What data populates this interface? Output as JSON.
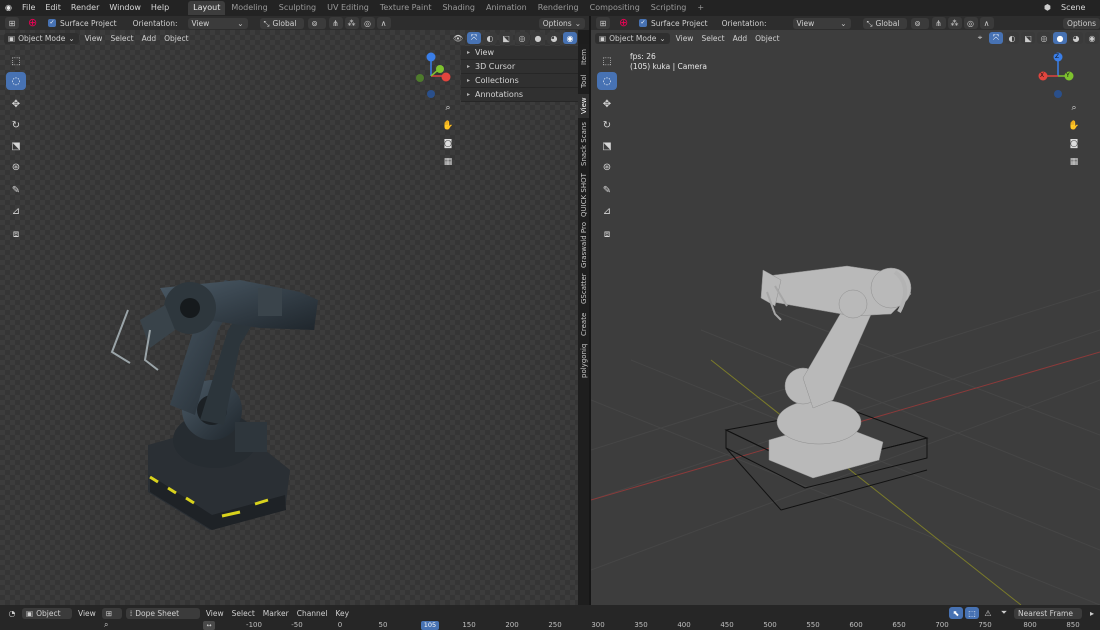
{
  "menu": [
    "File",
    "Edit",
    "Render",
    "Window",
    "Help"
  ],
  "workspaces": [
    {
      "label": "Layout",
      "active": true
    },
    {
      "label": "Modeling"
    },
    {
      "label": "Sculpting"
    },
    {
      "label": "UV Editing"
    },
    {
      "label": "Texture Paint"
    },
    {
      "label": "Shading"
    },
    {
      "label": "Animation"
    },
    {
      "label": "Rendering"
    },
    {
      "label": "Compositing"
    },
    {
      "label": "Scripting"
    }
  ],
  "add_workspace": "+",
  "scene_label": "Scene",
  "left": {
    "surface_project": "Surface Project",
    "orientation_label": "Orientation:",
    "orientation_value": "View",
    "transform": "Global",
    "options": "Options",
    "mode": "Object Mode",
    "menus": [
      "View",
      "Select",
      "Add",
      "Object"
    ],
    "npanel_rows": [
      "View",
      "3D Cursor",
      "Collections",
      "Annotations"
    ],
    "side_tabs": [
      "Item",
      "Tool",
      "View",
      "Snack Scans",
      "QUICK SHOT",
      "Graswald Pro",
      "GScatter",
      "Create",
      "polygoniq"
    ]
  },
  "right": {
    "surface_project": "Surface Project",
    "orientation_label": "Orientation:",
    "orientation_value": "View",
    "transform": "Global",
    "options": "Options",
    "mode": "Object Mode",
    "menus": [
      "View",
      "Select",
      "Add",
      "Object"
    ],
    "fps": "fps: 26",
    "camera": "(105) kuka | Camera"
  },
  "gizmo_axes": {
    "x": "X",
    "y": "Y",
    "z": "Z"
  },
  "timeline": {
    "object": "Object",
    "view": "View",
    "dope_sheet": "Dope Sheet",
    "menus": [
      "View",
      "Select",
      "Marker",
      "Channel",
      "Key"
    ],
    "interpolation": "Nearest Frame",
    "current_frame": "105",
    "ticks": [
      "-100",
      "-50",
      "0",
      "50",
      "150",
      "200",
      "250",
      "300",
      "350",
      "400",
      "450",
      "500",
      "550",
      "600",
      "650",
      "700",
      "750",
      "800",
      "850"
    ]
  },
  "colors": {
    "accent": "#4772b3",
    "x_axis": "#e0453e",
    "y_axis": "#7ec22e",
    "z_axis": "#3a7ee8"
  }
}
